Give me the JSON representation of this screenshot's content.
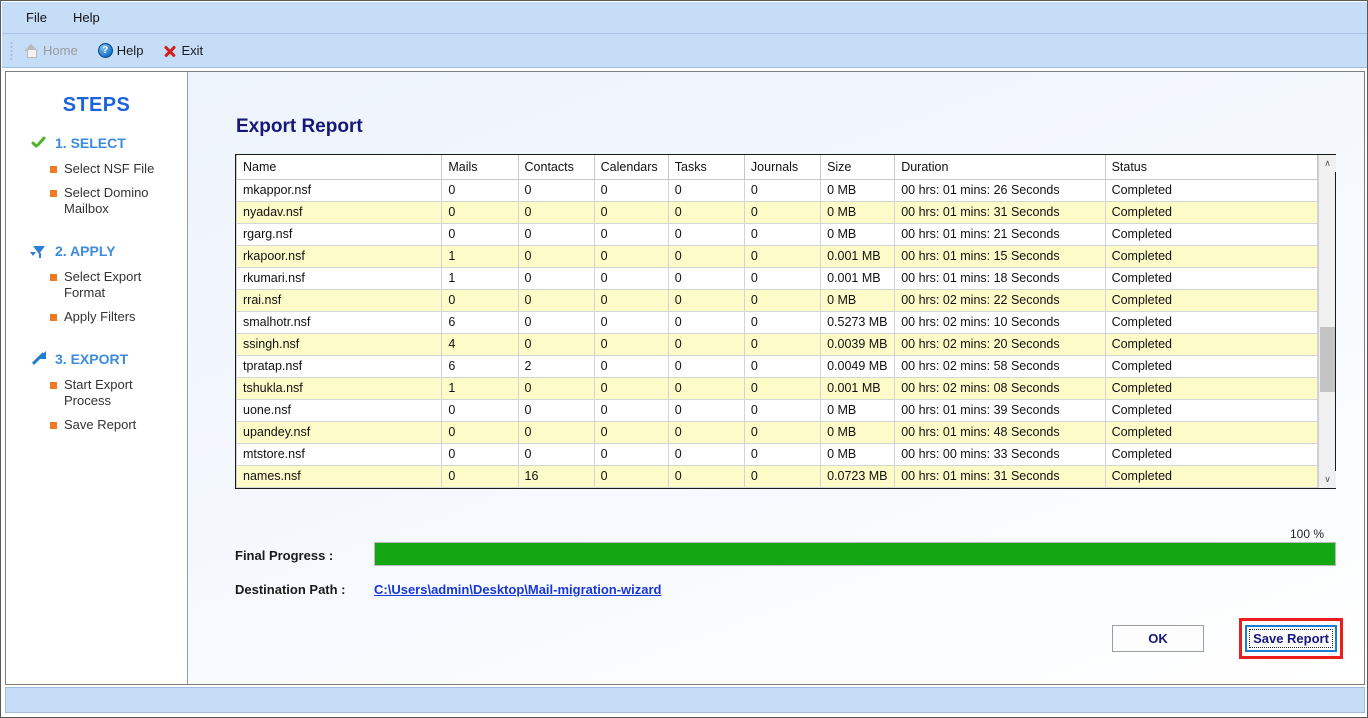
{
  "menubar": {
    "items": [
      {
        "label": "File"
      },
      {
        "label": "Help"
      }
    ]
  },
  "toolbar": {
    "items": [
      {
        "label": "Home",
        "icon": "home-icon",
        "enabled": false
      },
      {
        "label": "Help",
        "icon": "help-icon",
        "enabled": true
      },
      {
        "label": "Exit",
        "icon": "exit-icon",
        "enabled": true
      }
    ],
    "help_glyph": "?"
  },
  "sidebar": {
    "title": "STEPS",
    "groups": [
      {
        "icon": "green-check-icon",
        "title": "1. SELECT",
        "items": [
          "Select NSF File",
          "Select Domino Mailbox"
        ]
      },
      {
        "icon": "filter-funnel-icon",
        "title": "2. APPLY",
        "items": [
          "Select Export Format",
          "Apply Filters"
        ]
      },
      {
        "icon": "export-arrow-icon",
        "title": "3. EXPORT",
        "items": [
          "Start Export Process",
          "Save Report"
        ]
      }
    ]
  },
  "main": {
    "page_title": "Export Report",
    "table": {
      "columns": [
        "Name",
        "Mails",
        "Contacts",
        "Calendars",
        "Tasks",
        "Journals",
        "Size",
        "Duration",
        "Status"
      ],
      "rows": [
        [
          "mkappor.nsf",
          "0",
          "0",
          "0",
          "0",
          "0",
          "0 MB",
          "00 hrs: 01 mins: 26 Seconds",
          "Completed"
        ],
        [
          "nyadav.nsf",
          "0",
          "0",
          "0",
          "0",
          "0",
          "0 MB",
          "00 hrs: 01 mins: 31 Seconds",
          "Completed"
        ],
        [
          "rgarg.nsf",
          "0",
          "0",
          "0",
          "0",
          "0",
          "0 MB",
          "00 hrs: 01 mins: 21 Seconds",
          "Completed"
        ],
        [
          "rkapoor.nsf",
          "1",
          "0",
          "0",
          "0",
          "0",
          "0.001 MB",
          "00 hrs: 01 mins: 15 Seconds",
          "Completed"
        ],
        [
          "rkumari.nsf",
          "1",
          "0",
          "0",
          "0",
          "0",
          "0.001 MB",
          "00 hrs: 01 mins: 18 Seconds",
          "Completed"
        ],
        [
          "rrai.nsf",
          "0",
          "0",
          "0",
          "0",
          "0",
          "0 MB",
          "00 hrs: 02 mins: 22 Seconds",
          "Completed"
        ],
        [
          "smalhotr.nsf",
          "6",
          "0",
          "0",
          "0",
          "0",
          "0.5273 MB",
          "00 hrs: 02 mins: 10 Seconds",
          "Completed"
        ],
        [
          "ssingh.nsf",
          "4",
          "0",
          "0",
          "0",
          "0",
          "0.0039 MB",
          "00 hrs: 02 mins: 20 Seconds",
          "Completed"
        ],
        [
          "tpratap.nsf",
          "6",
          "2",
          "0",
          "0",
          "0",
          "0.0049 MB",
          "00 hrs: 02 mins: 58 Seconds",
          "Completed"
        ],
        [
          "tshukla.nsf",
          "1",
          "0",
          "0",
          "0",
          "0",
          "0.001 MB",
          "00 hrs: 02 mins: 08 Seconds",
          "Completed"
        ],
        [
          "uone.nsf",
          "0",
          "0",
          "0",
          "0",
          "0",
          "0 MB",
          "00 hrs: 01 mins: 39 Seconds",
          "Completed"
        ],
        [
          "upandey.nsf",
          "0",
          "0",
          "0",
          "0",
          "0",
          "0 MB",
          "00 hrs: 01 mins: 48 Seconds",
          "Completed"
        ],
        [
          "mtstore.nsf",
          "0",
          "0",
          "0",
          "0",
          "0",
          "0 MB",
          "00 hrs: 00 mins: 33 Seconds",
          "Completed"
        ],
        [
          "names.nsf",
          "0",
          "16",
          "0",
          "0",
          "0",
          "0.0723 MB",
          "00 hrs: 01 mins: 31 Seconds",
          "Completed"
        ]
      ]
    },
    "progress": {
      "percent_label": "100 %",
      "percent_value": 100,
      "label": "Final Progress :",
      "fill_color": "#13a813"
    },
    "destination": {
      "label": "Destination Path  :",
      "path": "C:\\Users\\admin\\Desktop\\Mail-migration-wizard"
    },
    "buttons": {
      "ok": "OK",
      "save_report": "Save Report",
      "highlight_color": "#ee1d1d"
    },
    "scrollbar": {
      "up_glyph": "∧",
      "down_glyph": "∨"
    }
  }
}
